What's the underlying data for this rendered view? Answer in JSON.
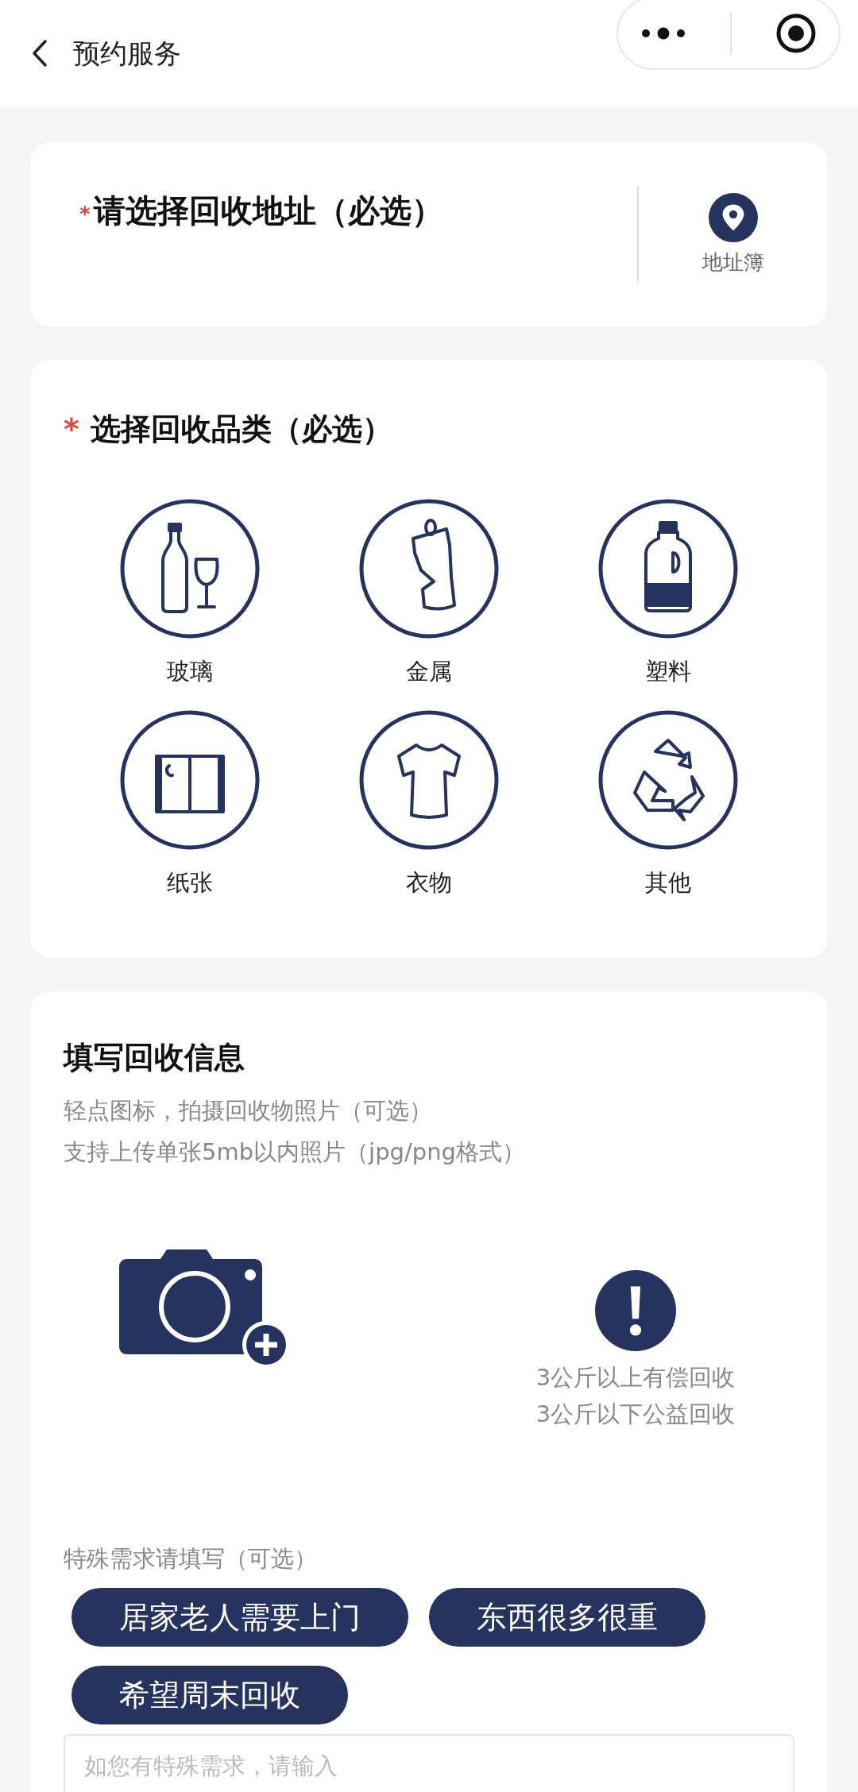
{
  "header": {
    "title": "预约服务"
  },
  "address": {
    "required_mark": "*",
    "title": "请选择回收地址（必选）",
    "book_label": "地址簿"
  },
  "categories": {
    "required_mark": "*",
    "title": "选择回收品类（必选）",
    "items": [
      {
        "label": "玻璃",
        "kind": "glass"
      },
      {
        "label": "金属",
        "kind": "metal"
      },
      {
        "label": "塑料",
        "kind": "plastic"
      },
      {
        "label": "纸张",
        "kind": "paper"
      },
      {
        "label": "衣物",
        "kind": "clothes"
      },
      {
        "label": "其他",
        "kind": "other"
      }
    ]
  },
  "info": {
    "title": "填写回收信息",
    "hints": [
      "轻点图标，拍摄回收物照片（可选）",
      "支持上传单张5mb以内照片（jpg/png格式）"
    ],
    "notice": [
      "3公斤以上有偿回收",
      "3公斤以下公益回收"
    ],
    "special_label": "特殊需求请填写（可选）",
    "chips": [
      "居家老人需要上门",
      "东西很多很重",
      "希望周末回收"
    ],
    "input": {
      "placeholder": "如您有特殊需求，请输入"
    }
  }
}
